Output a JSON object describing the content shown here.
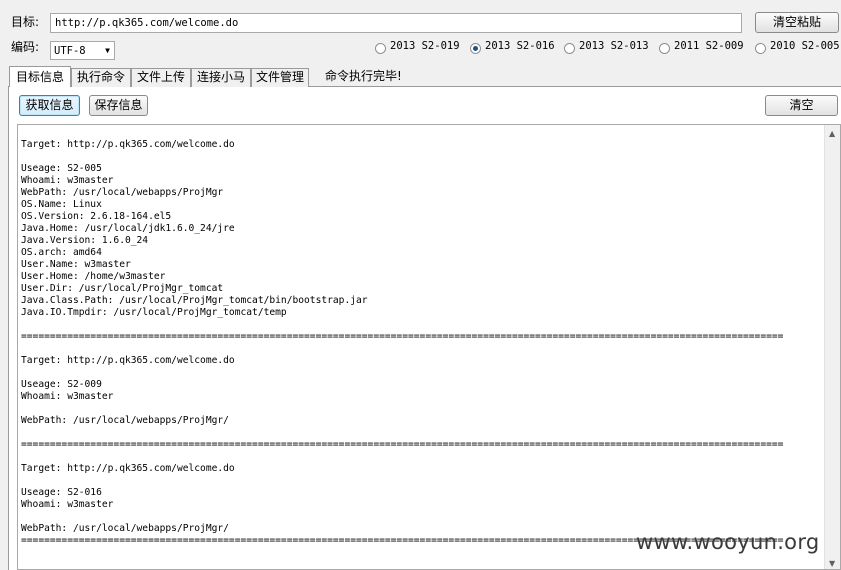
{
  "target": {
    "label": "目标:",
    "url_value": "http://p.qk365.com/welcome.do",
    "clear_paste_label": "清空粘贴"
  },
  "encoding": {
    "label": "编码:",
    "selected": "UTF-8"
  },
  "exploits": [
    {
      "label": "2013 S2-019",
      "checked": false
    },
    {
      "label": "2013 S2-016",
      "checked": true
    },
    {
      "label": "2013 S2-013",
      "checked": false
    },
    {
      "label": "2011 S2-009",
      "checked": false
    },
    {
      "label": "2010 S2-005",
      "checked": false
    }
  ],
  "tabs": [
    {
      "label": "目标信息",
      "active": true
    },
    {
      "label": "执行命令",
      "active": false
    },
    {
      "label": "文件上传",
      "active": false
    },
    {
      "label": "连接小马",
      "active": false
    },
    {
      "label": "文件管理",
      "active": false
    }
  ],
  "status_text": "命令执行完毕!",
  "actions": {
    "get_info_label": "获取信息",
    "save_info_label": "保存信息",
    "clear_label": "清空"
  },
  "output_lines": [
    "Target: http://p.qk365.com/welcome.do",
    "",
    "Useage: S2-005",
    "Whoami: w3master",
    "WebPath: /usr/local/webapps/ProjMgr",
    "OS.Name: Linux",
    "OS.Version: 2.6.18-164.el5",
    "Java.Home: /usr/local/jdk1.6.0_24/jre",
    "Java.Version: 1.6.0_24",
    "OS.arch: amd64",
    "User.Name: w3master",
    "User.Home: /home/w3master",
    "User.Dir: /usr/local/ProjMgr_tomcat",
    "Java.Class.Path: /usr/local/ProjMgr_tomcat/bin/bootstrap.jar",
    "Java.IO.Tmpdir: /usr/local/ProjMgr_tomcat/temp",
    "",
    "====================================================================================================================================",
    "",
    "Target: http://p.qk365.com/welcome.do",
    "",
    "Useage: S2-009",
    "Whoami: w3master",
    "",
    "WebPath: /usr/local/webapps/ProjMgr/",
    "",
    "====================================================================================================================================",
    "",
    "Target: http://p.qk365.com/welcome.do",
    "",
    "Useage: S2-016",
    "Whoami: w3master",
    "",
    "WebPath: /usr/local/webapps/ProjMgr/",
    "===================================================================================================================================="
  ],
  "watermark": "www.wooyun.org",
  "icons": {
    "dropdown": "chevron-down-icon",
    "scroll_up": "scroll-up-arrow-icon",
    "scroll_down": "scroll-down-arrow-icon"
  }
}
